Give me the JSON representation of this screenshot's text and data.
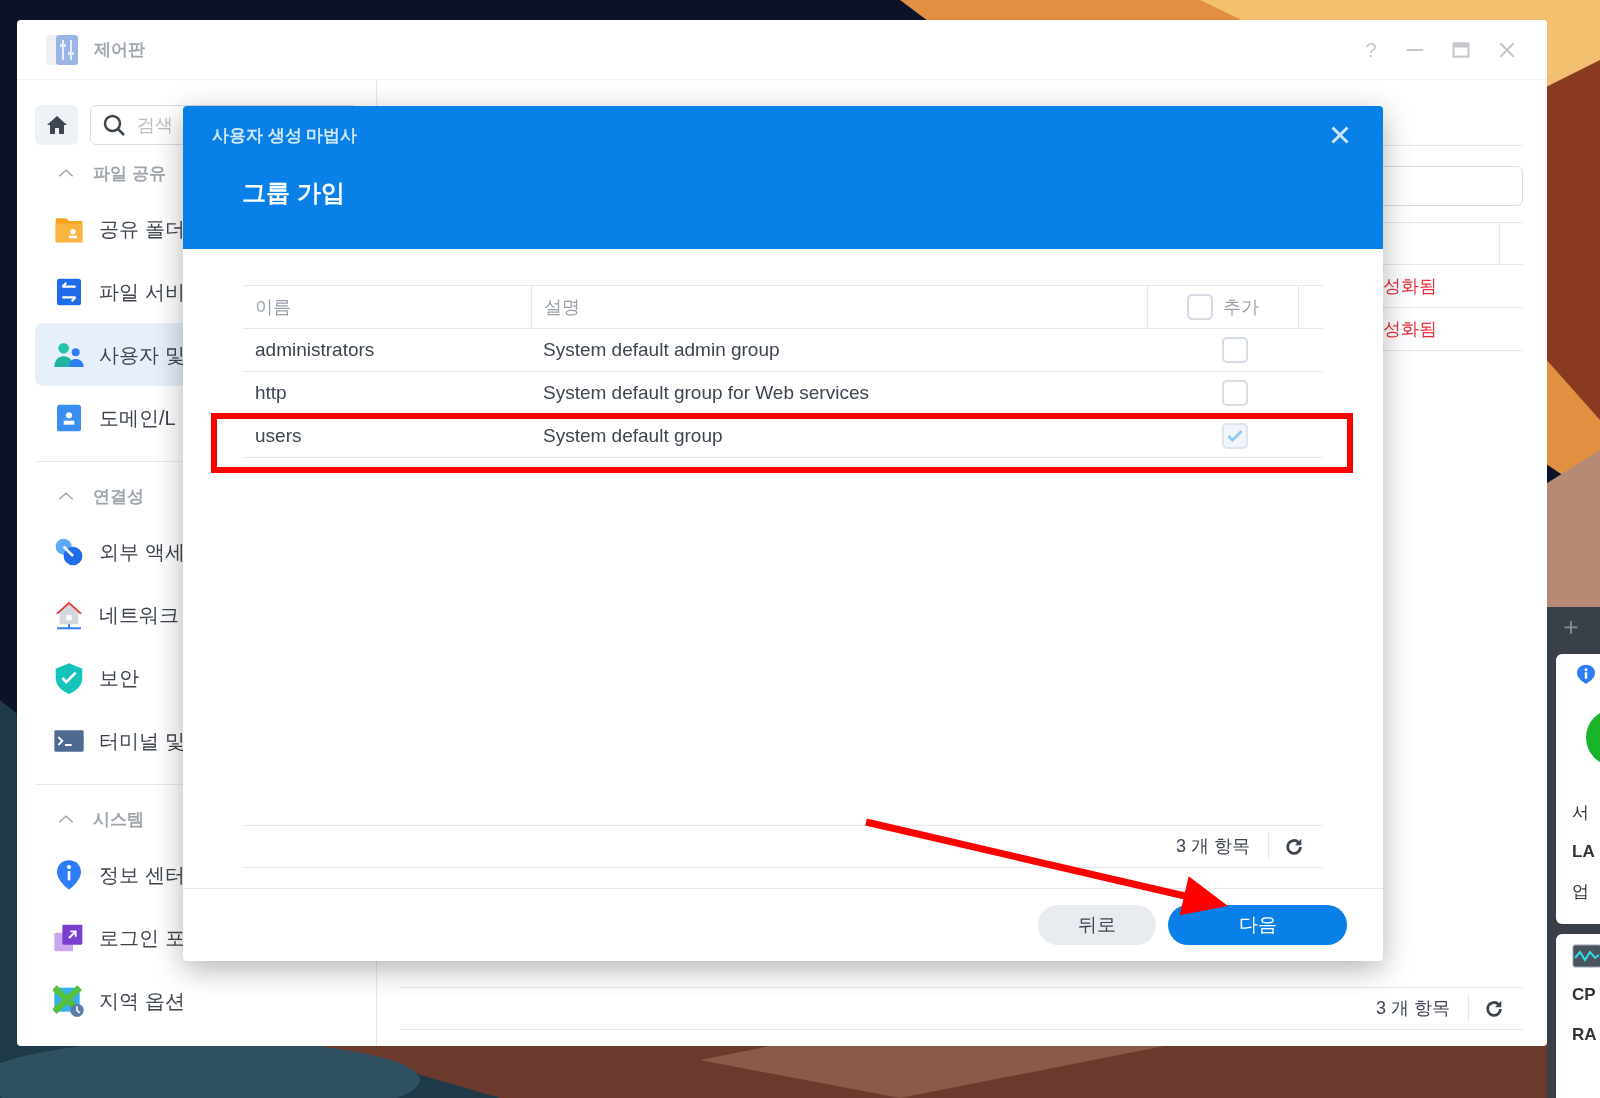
{
  "window": {
    "title": "제어판",
    "help": "?"
  },
  "sidebar": {
    "search": {
      "placeholder": "검색"
    },
    "sections": [
      {
        "title": "파일 공유",
        "expanded": true,
        "items": [
          {
            "label": "공유 폴더",
            "selected": false
          },
          {
            "label": "파일 서비",
            "selected": false
          },
          {
            "label": "사용자 및",
            "selected": true
          },
          {
            "label": "도메인/L",
            "selected": false
          }
        ]
      },
      {
        "title": "연결성",
        "expanded": true,
        "items": [
          {
            "label": "외부 액세",
            "selected": false
          },
          {
            "label": "네트워크",
            "selected": false
          },
          {
            "label": "보안",
            "selected": false
          },
          {
            "label": "터미널 및",
            "selected": false
          }
        ]
      },
      {
        "title": "시스템",
        "expanded": true,
        "items": [
          {
            "label": "정보 센터",
            "selected": false
          },
          {
            "label": "로그인 포",
            "selected": false
          },
          {
            "label": "지역 옵션",
            "selected": false
          }
        ]
      }
    ]
  },
  "main_panel": {
    "status_cells": [
      "성화됨",
      "성화됨"
    ],
    "count": "3 개 항목"
  },
  "dialog": {
    "title": "사용자 생성 마법사",
    "heading": "그룹 가입",
    "columns": [
      "이름",
      "설명",
      "추가"
    ],
    "select_all": {
      "checked": false
    },
    "rows": [
      {
        "name": "administrators",
        "description": "System default admin group",
        "checked": false,
        "disabled": false
      },
      {
        "name": "http",
        "description": "System default group for Web services",
        "checked": false,
        "disabled": false
      },
      {
        "name": "users",
        "description": "System default group",
        "checked": true,
        "disabled": true
      }
    ],
    "count": "3 개 항목",
    "buttons": [
      {
        "label": "뒤로",
        "kind": "secondary"
      },
      {
        "label": "다음",
        "kind": "primary"
      }
    ]
  },
  "annotations": [
    {
      "kind": "box"
    },
    {
      "kind": "arrow"
    }
  ],
  "widgets": [
    {
      "lines": [
        {
          "text": "서",
          "bold": false
        },
        {
          "text": "LA",
          "bold": true
        },
        {
          "text": "업",
          "bold": false
        }
      ]
    },
    {
      "lines": [
        {
          "text": "CP",
          "bold": true
        },
        {
          "text": "RA",
          "bold": true
        }
      ]
    }
  ]
}
